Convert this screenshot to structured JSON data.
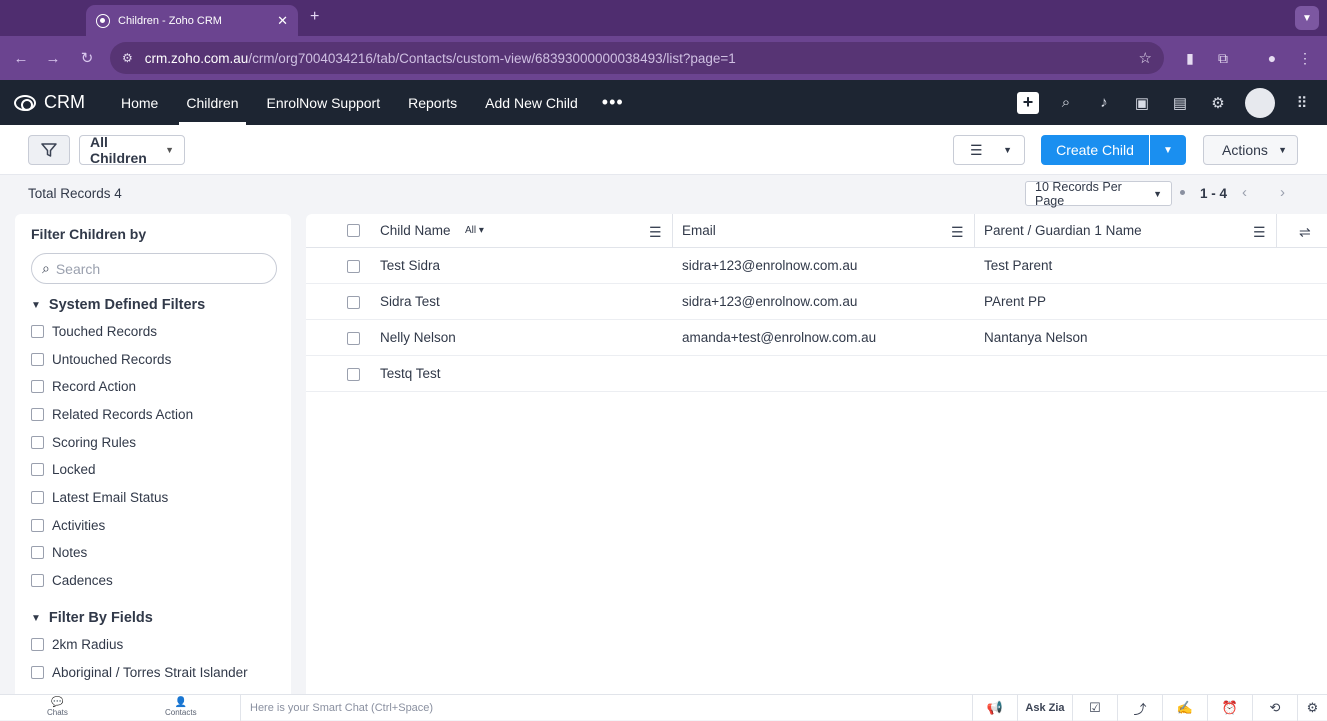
{
  "browser": {
    "tab_title": "Children - Zoho CRM",
    "tab_close": "✕",
    "new_tab": "+",
    "url_host": "crm.zoho.com.au",
    "url_path": "/crm/org7004034216/tab/Contacts/custom-view/68393000000038493/list?page=1"
  },
  "crmnav": {
    "logo": "CRM",
    "items": [
      "Home",
      "Children",
      "EnrolNow Support",
      "Reports",
      "Add New Child"
    ],
    "active": "Children",
    "more": "•••",
    "icons": [
      "plus-icon",
      "search-icon",
      "bell-icon",
      "calendar-icon",
      "marketplace-icon",
      "gear-icon",
      "avatar",
      "apps-grid-icon"
    ]
  },
  "toolbar": {
    "view_name": "All Children",
    "create_label": "Create Child",
    "actions_label": "Actions"
  },
  "summary": {
    "total_records": "Total Records 4",
    "per_page": "10 Records Per Page",
    "page_range": "1 - 4"
  },
  "sidebar": {
    "title": "Filter Children by",
    "search_placeholder": "Search",
    "system_section": "System Defined Filters",
    "system_filters": [
      "Touched Records",
      "Untouched Records",
      "Record Action",
      "Related Records Action",
      "Scoring Rules",
      "Locked",
      "Latest Email Status",
      "Activities",
      "Notes",
      "Cadences"
    ],
    "fields_section": "Filter By Fields",
    "field_filters": [
      "2km Radius",
      "Aboriginal / Torres Strait Islander"
    ]
  },
  "table": {
    "columns": [
      "Child Name",
      "Email",
      "Parent / Guardian 1 Name"
    ],
    "name_filter": "All",
    "rows": [
      {
        "name": "Test Sidra",
        "email": "sidra+123@enrolnow.com.au",
        "parent": "Test Parent"
      },
      {
        "name": "Sidra Test",
        "email": "sidra+123@enrolnow.com.au",
        "parent": "PArent PP"
      },
      {
        "name": "Nelly Nelson",
        "email": "amanda+test@enrolnow.com.au",
        "parent": "Nantanya Nelson"
      },
      {
        "name": "Testq Test",
        "email": "",
        "parent": ""
      }
    ]
  },
  "chatbar": {
    "chats": "Chats",
    "contacts": "Contacts",
    "placeholder": "Here is your Smart Chat (Ctrl+Space)",
    "ask_zia": "Ask Zia"
  },
  "colors": {
    "tabstrip": "#4f2d6f",
    "toolbar": "#6b4490",
    "crm_nav": "#1d2532",
    "primary_button": "#1a8ff0"
  }
}
